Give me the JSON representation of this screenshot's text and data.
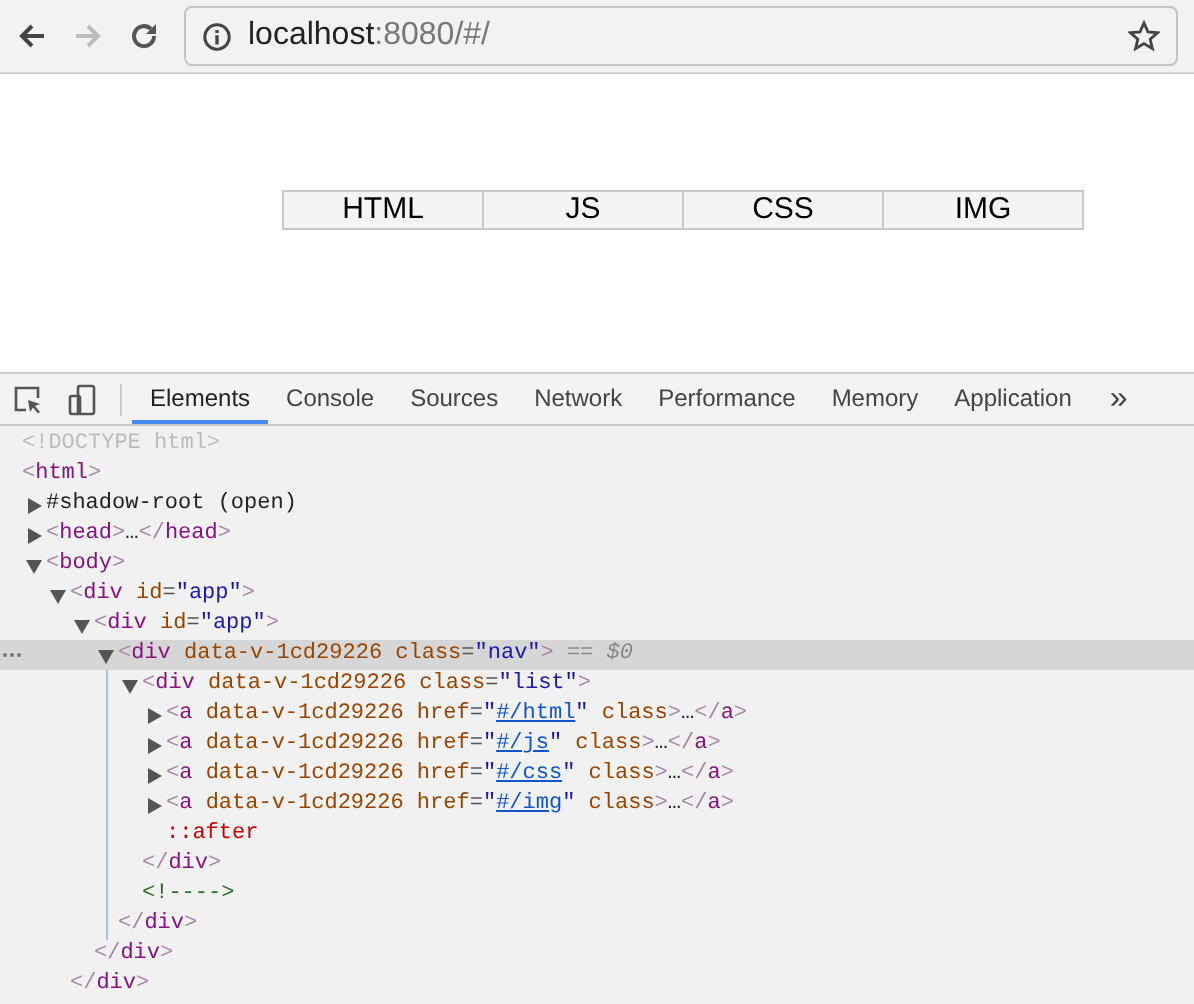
{
  "browser": {
    "back_disabled": false,
    "forward_disabled": true,
    "url_host": "localhost",
    "url_rest": ":8080/#/"
  },
  "page": {
    "nav_links": [
      "HTML",
      "JS",
      "CSS",
      "IMG"
    ]
  },
  "devtools": {
    "tabs": [
      {
        "label": "Elements",
        "selected": true
      },
      {
        "label": "Console",
        "selected": false
      },
      {
        "label": "Sources",
        "selected": false
      },
      {
        "label": "Network",
        "selected": false
      },
      {
        "label": "Performance",
        "selected": false
      },
      {
        "label": "Memory",
        "selected": false
      },
      {
        "label": "Application",
        "selected": false
      }
    ],
    "overflow": "»",
    "elements_tree": [
      {
        "selected": false,
        "segments": [
          {
            "kind": "doctype",
            "text": "<!DOCTYPE html>"
          }
        ]
      },
      {
        "selected": false,
        "segments": [
          {
            "kind": "bracket",
            "text": "<"
          },
          {
            "kind": "tag",
            "text": "html"
          },
          {
            "kind": "bracket",
            "text": ">"
          }
        ],
        "children": [
          {
            "selected": false,
            "expanded": false,
            "segments": [
              {
                "kind": "text",
                "text": "#shadow-root (open)"
              }
            ]
          },
          {
            "selected": false,
            "expanded": false,
            "segments": [
              {
                "kind": "bracket",
                "text": "<"
              },
              {
                "kind": "tag",
                "text": "head"
              },
              {
                "kind": "bracket",
                "text": ">"
              },
              {
                "kind": "text",
                "text": "…"
              },
              {
                "kind": "bracket",
                "text": "</"
              },
              {
                "kind": "tag",
                "text": "head"
              },
              {
                "kind": "bracket",
                "text": ">"
              }
            ]
          },
          {
            "selected": false,
            "expanded": true,
            "segments": [
              {
                "kind": "bracket",
                "text": "<"
              },
              {
                "kind": "tag",
                "text": "body"
              },
              {
                "kind": "bracket",
                "text": ">"
              }
            ],
            "children": [
              {
                "selected": false,
                "expanded": true,
                "segments": [
                  {
                    "kind": "bracket",
                    "text": "<"
                  },
                  {
                    "kind": "tag",
                    "text": "div"
                  },
                  {
                    "kind": "attr",
                    "text": " id"
                  },
                  {
                    "kind": "eq",
                    "text": "="
                  },
                  {
                    "kind": "value",
                    "text": "\"app\""
                  },
                  {
                    "kind": "bracket",
                    "text": ">"
                  }
                ],
                "closing": [
                  {
                    "kind": "bracket",
                    "text": "</"
                  },
                  {
                    "kind": "tag",
                    "text": "div"
                  },
                  {
                    "kind": "bracket",
                    "text": ">"
                  }
                ],
                "children": [
                  {
                    "selected": false,
                    "expanded": true,
                    "segments": [
                      {
                        "kind": "bracket",
                        "text": "<"
                      },
                      {
                        "kind": "tag",
                        "text": "div"
                      },
                      {
                        "kind": "attr",
                        "text": " id"
                      },
                      {
                        "kind": "eq",
                        "text": "="
                      },
                      {
                        "kind": "value",
                        "text": "\"app\""
                      },
                      {
                        "kind": "bracket",
                        "text": ">"
                      }
                    ],
                    "closing": [
                      {
                        "kind": "bracket",
                        "text": "</"
                      },
                      {
                        "kind": "tag",
                        "text": "div"
                      },
                      {
                        "kind": "bracket",
                        "text": ">"
                      }
                    ],
                    "children": [
                      {
                        "selected": true,
                        "expanded": true,
                        "segments": [
                          {
                            "kind": "bracket",
                            "text": "<"
                          },
                          {
                            "kind": "tag",
                            "text": "div"
                          },
                          {
                            "kind": "attr",
                            "text": " data-v-1cd29226 class"
                          },
                          {
                            "kind": "eq",
                            "text": "="
                          },
                          {
                            "kind": "value",
                            "text": "\"nav\""
                          },
                          {
                            "kind": "bracket",
                            "text": ">"
                          },
                          {
                            "kind": "hint",
                            "text": " == "
                          },
                          {
                            "kind": "var",
                            "text": "$0"
                          }
                        ],
                        "closing": [
                          {
                            "kind": "bracket",
                            "text": "</"
                          },
                          {
                            "kind": "tag",
                            "text": "div"
                          },
                          {
                            "kind": "bracket",
                            "text": ">"
                          }
                        ],
                        "children": [
                          {
                            "selected": false,
                            "expanded": true,
                            "segments": [
                              {
                                "kind": "bracket",
                                "text": "<"
                              },
                              {
                                "kind": "tag",
                                "text": "div"
                              },
                              {
                                "kind": "attr",
                                "text": " data-v-1cd29226 class"
                              },
                              {
                                "kind": "eq",
                                "text": "="
                              },
                              {
                                "kind": "value",
                                "text": "\"list\""
                              },
                              {
                                "kind": "bracket",
                                "text": ">"
                              }
                            ],
                            "closing": [
                              {
                                "kind": "bracket",
                                "text": "</"
                              },
                              {
                                "kind": "tag",
                                "text": "div"
                              },
                              {
                                "kind": "bracket",
                                "text": ">"
                              }
                            ],
                            "children": [
                              {
                                "selected": false,
                                "expanded": false,
                                "segments": [
                                  {
                                    "kind": "bracket",
                                    "text": "<"
                                  },
                                  {
                                    "kind": "tag",
                                    "text": "a"
                                  },
                                  {
                                    "kind": "attr",
                                    "text": " data-v-1cd29226 href"
                                  },
                                  {
                                    "kind": "eq",
                                    "text": "="
                                  },
                                  {
                                    "kind": "value",
                                    "text": "\""
                                  },
                                  {
                                    "kind": "link",
                                    "text": "#/html"
                                  },
                                  {
                                    "kind": "value",
                                    "text": "\""
                                  },
                                  {
                                    "kind": "attr",
                                    "text": " class"
                                  },
                                  {
                                    "kind": "bracket",
                                    "text": ">"
                                  },
                                  {
                                    "kind": "text",
                                    "text": "…"
                                  },
                                  {
                                    "kind": "bracket",
                                    "text": "</"
                                  },
                                  {
                                    "kind": "tag",
                                    "text": "a"
                                  },
                                  {
                                    "kind": "bracket",
                                    "text": ">"
                                  }
                                ]
                              },
                              {
                                "selected": false,
                                "expanded": false,
                                "segments": [
                                  {
                                    "kind": "bracket",
                                    "text": "<"
                                  },
                                  {
                                    "kind": "tag",
                                    "text": "a"
                                  },
                                  {
                                    "kind": "attr",
                                    "text": " data-v-1cd29226 href"
                                  },
                                  {
                                    "kind": "eq",
                                    "text": "="
                                  },
                                  {
                                    "kind": "value",
                                    "text": "\""
                                  },
                                  {
                                    "kind": "link",
                                    "text": "#/js"
                                  },
                                  {
                                    "kind": "value",
                                    "text": "\""
                                  },
                                  {
                                    "kind": "attr",
                                    "text": " class"
                                  },
                                  {
                                    "kind": "bracket",
                                    "text": ">"
                                  },
                                  {
                                    "kind": "text",
                                    "text": "…"
                                  },
                                  {
                                    "kind": "bracket",
                                    "text": "</"
                                  },
                                  {
                                    "kind": "tag",
                                    "text": "a"
                                  },
                                  {
                                    "kind": "bracket",
                                    "text": ">"
                                  }
                                ]
                              },
                              {
                                "selected": false,
                                "expanded": false,
                                "segments": [
                                  {
                                    "kind": "bracket",
                                    "text": "<"
                                  },
                                  {
                                    "kind": "tag",
                                    "text": "a"
                                  },
                                  {
                                    "kind": "attr",
                                    "text": " data-v-1cd29226 href"
                                  },
                                  {
                                    "kind": "eq",
                                    "text": "="
                                  },
                                  {
                                    "kind": "value",
                                    "text": "\""
                                  },
                                  {
                                    "kind": "link",
                                    "text": "#/css"
                                  },
                                  {
                                    "kind": "value",
                                    "text": "\""
                                  },
                                  {
                                    "kind": "attr",
                                    "text": " class"
                                  },
                                  {
                                    "kind": "bracket",
                                    "text": ">"
                                  },
                                  {
                                    "kind": "text",
                                    "text": "…"
                                  },
                                  {
                                    "kind": "bracket",
                                    "text": "</"
                                  },
                                  {
                                    "kind": "tag",
                                    "text": "a"
                                  },
                                  {
                                    "kind": "bracket",
                                    "text": ">"
                                  }
                                ]
                              },
                              {
                                "selected": false,
                                "expanded": false,
                                "segments": [
                                  {
                                    "kind": "bracket",
                                    "text": "<"
                                  },
                                  {
                                    "kind": "tag",
                                    "text": "a"
                                  },
                                  {
                                    "kind": "attr",
                                    "text": " data-v-1cd29226 href"
                                  },
                                  {
                                    "kind": "eq",
                                    "text": "="
                                  },
                                  {
                                    "kind": "value",
                                    "text": "\""
                                  },
                                  {
                                    "kind": "link",
                                    "text": "#/img"
                                  },
                                  {
                                    "kind": "value",
                                    "text": "\""
                                  },
                                  {
                                    "kind": "attr",
                                    "text": " class"
                                  },
                                  {
                                    "kind": "bracket",
                                    "text": ">"
                                  },
                                  {
                                    "kind": "text",
                                    "text": "…"
                                  },
                                  {
                                    "kind": "bracket",
                                    "text": "</"
                                  },
                                  {
                                    "kind": "tag",
                                    "text": "a"
                                  },
                                  {
                                    "kind": "bracket",
                                    "text": ">"
                                  }
                                ]
                              },
                              {
                                "selected": false,
                                "segments": [
                                  {
                                    "kind": "pseudo",
                                    "text": "::after"
                                  }
                                ]
                              }
                            ]
                          },
                          {
                            "selected": false,
                            "segments": [
                              {
                                "kind": "comment",
                                "text": "<!---->"
                              }
                            ]
                          }
                        ]
                      }
                    ]
                  }
                ]
              }
            ]
          }
        ]
      }
    ]
  }
}
